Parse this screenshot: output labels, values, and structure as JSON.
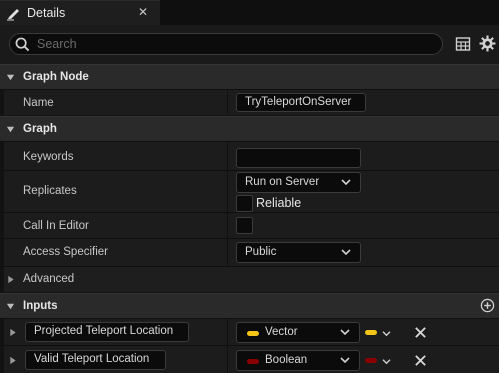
{
  "tab": {
    "icon": "pencil-icon",
    "label": "Details",
    "close": "✕"
  },
  "search": {
    "placeholder": "Search"
  },
  "toolbar": {
    "grid_icon": "table-view-icon",
    "settings_icon": "gear-icon"
  },
  "sections": {
    "graph_node": {
      "title": "Graph Node",
      "name_label": "Name",
      "name_value": "TryTeleportOnServer"
    },
    "graph": {
      "title": "Graph",
      "keywords_label": "Keywords",
      "keywords_value": "",
      "replicates_label": "Replicates",
      "replicates_value": "Run on Server",
      "reliable_label": "Reliable",
      "call_in_editor_label": "Call In Editor",
      "access_label": "Access Specifier",
      "access_value": "Public"
    },
    "advanced": {
      "title": "Advanced"
    },
    "inputs": {
      "title": "Inputs",
      "pins": [
        {
          "name": "Projected Teleport Location",
          "type": "Vector",
          "color": "#f5c518"
        },
        {
          "name": "Valid Teleport Location",
          "type": "Boolean",
          "color": "#8b0000"
        }
      ]
    }
  },
  "colors": {
    "vector_pin": "#f5c518",
    "boolean_pin": "#8b0000"
  }
}
